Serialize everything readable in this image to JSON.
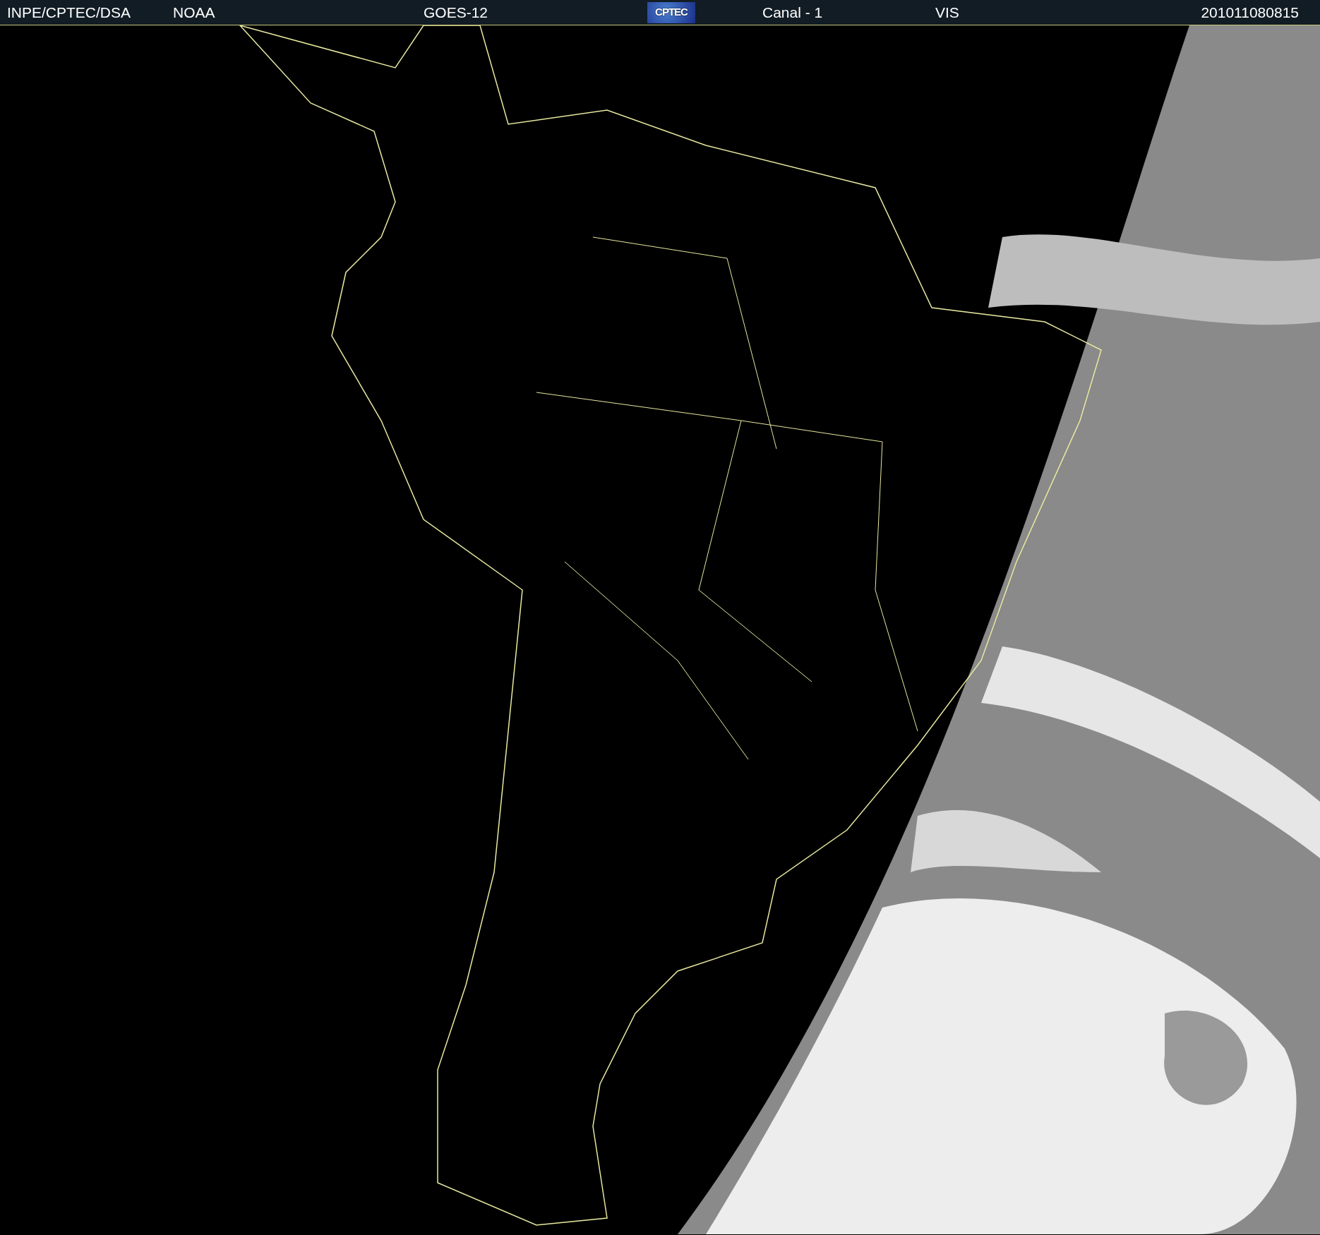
{
  "header": {
    "source": "INPE/CPTEC/DSA",
    "agency": "NOAA",
    "satellite": "GOES-12",
    "logo": "CPTEC",
    "channel": "Canal - 1",
    "band": "VIS",
    "timestamp": "201011080815"
  }
}
